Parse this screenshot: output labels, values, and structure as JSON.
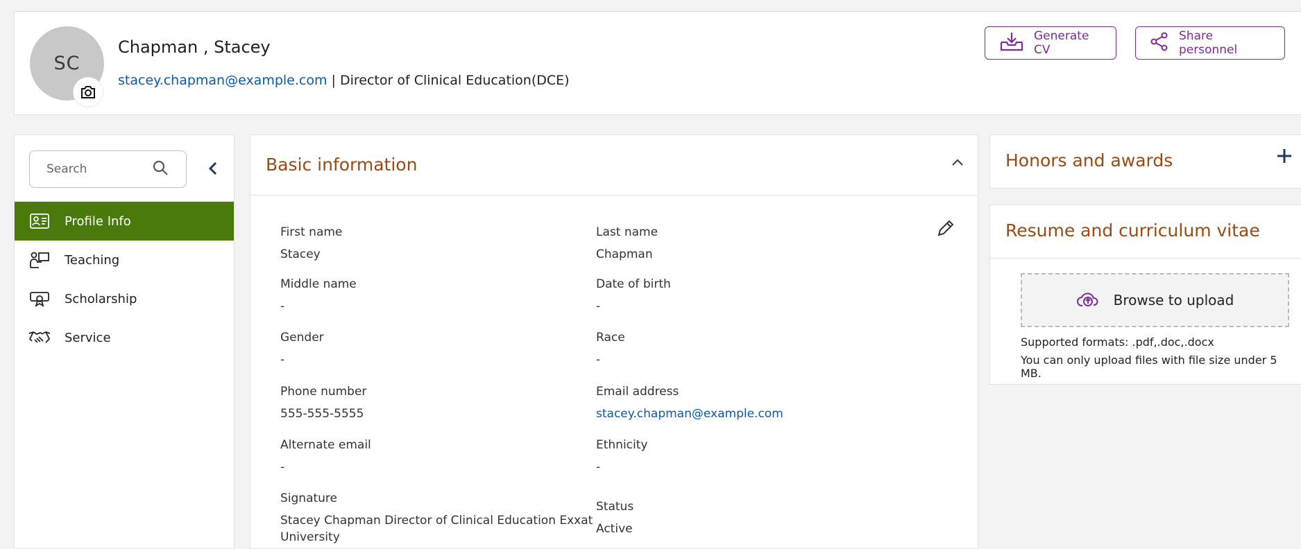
{
  "profile": {
    "initials": "SC",
    "name": "Chapman , Stacey",
    "email": "stacey.chapman@example.com",
    "separator": " | ",
    "role": "Director of Clinical Education(DCE)"
  },
  "actions": {
    "generate_cv": "Generate CV",
    "share_personnel": "Share personnel"
  },
  "sidebar": {
    "search_placeholder": "Search",
    "items": [
      {
        "label": "Profile Info",
        "icon": "profile-card-icon",
        "active": true
      },
      {
        "label": "Teaching",
        "icon": "teaching-icon",
        "active": false
      },
      {
        "label": "Scholarship",
        "icon": "scholarship-icon",
        "active": false
      },
      {
        "label": "Service",
        "icon": "handshake-icon",
        "active": false
      }
    ]
  },
  "basic_info": {
    "title": "Basic information",
    "fields": {
      "first_name": {
        "label": "First name",
        "value": "Stacey"
      },
      "last_name": {
        "label": "Last name",
        "value": "Chapman"
      },
      "middle_name": {
        "label": "Middle name",
        "value": "-"
      },
      "date_of_birth": {
        "label": "Date of birth",
        "value": "-"
      },
      "gender": {
        "label": "Gender",
        "value": "-"
      },
      "race": {
        "label": "Race",
        "value": "-"
      },
      "phone": {
        "label": "Phone number",
        "value": "555-555-5555"
      },
      "email": {
        "label": "Email address",
        "value": "stacey.chapman@example.com"
      },
      "alternate_email": {
        "label": "Alternate email",
        "value": "-"
      },
      "ethnicity": {
        "label": "Ethnicity",
        "value": "-"
      },
      "signature": {
        "label": "Signature",
        "value_line1": "Stacey Chapman Director of Clinical Education Exxat",
        "value_line2": "University"
      },
      "status": {
        "label": "Status",
        "value": "Active"
      }
    }
  },
  "honors": {
    "title": "Honors and awards"
  },
  "resume": {
    "title": "Resume and curriculum vitae",
    "upload_label": "Browse to upload",
    "formats": "Supported formats: .pdf,.doc,.docx",
    "size_note": "You can only upload files with file size under 5 MB."
  },
  "colors": {
    "accent_purple": "#7d2b9b",
    "section_title_brown": "#9a4a13",
    "active_nav_green": "#4a7a0c",
    "link_blue": "#0b5aa8"
  }
}
